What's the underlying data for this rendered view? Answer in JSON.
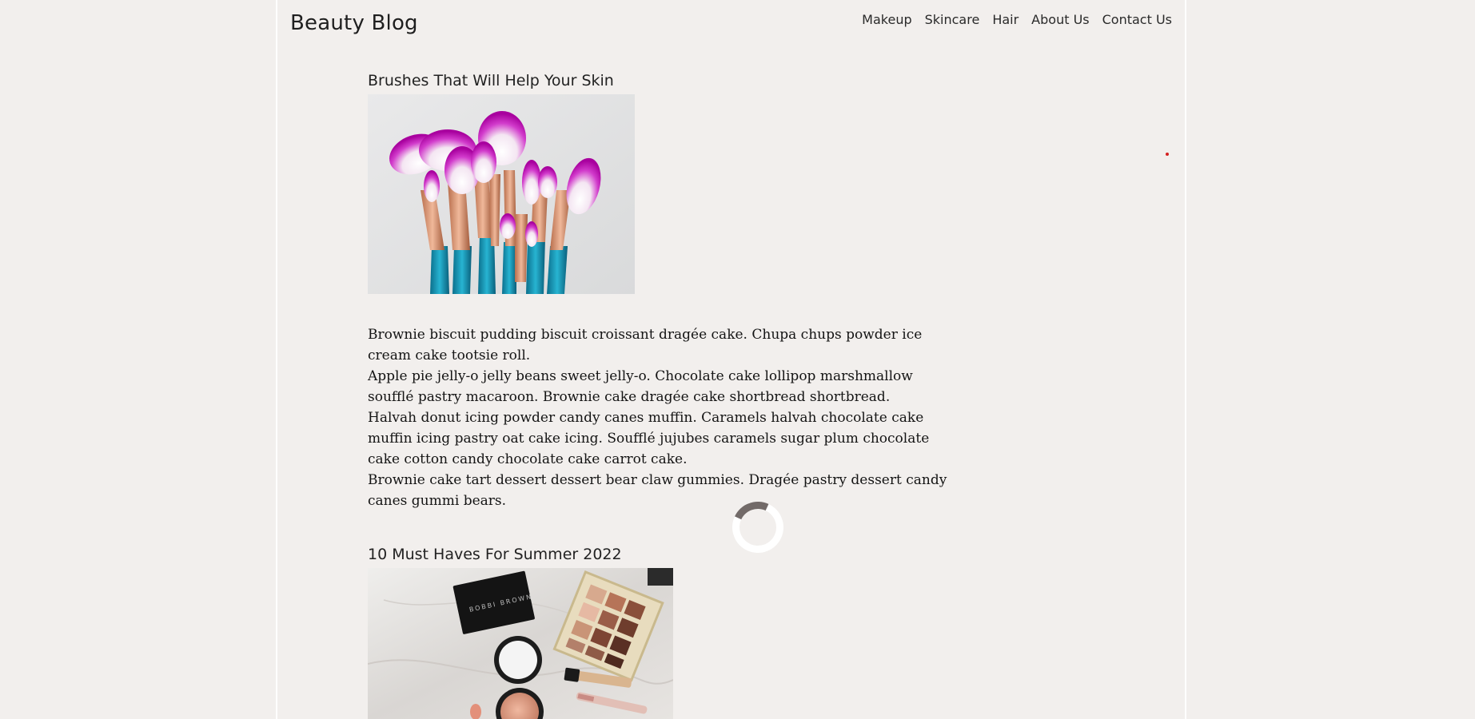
{
  "header": {
    "brand": "Beauty Blog",
    "nav": [
      {
        "label": "Makeup"
      },
      {
        "label": "Skincare"
      },
      {
        "label": "Hair"
      },
      {
        "label": "About Us"
      },
      {
        "label": "Contact Us"
      }
    ]
  },
  "posts": [
    {
      "title": "Brushes That Will Help Your Skin",
      "image_alt": "makeup brushes",
      "paragraphs": [
        "Brownie biscuit pudding biscuit croissant dragée cake. Chupa chups powder ice cream cake tootsie roll.",
        "Apple pie jelly-o jelly beans sweet jelly-o. Chocolate cake lollipop marshmallow soufflé pastry macaroon. Brownie cake dragée cake shortbread shortbread.",
        "Halvah donut icing powder candy canes muffin. Caramels halvah chocolate cake muffin icing pastry oat cake icing. Soufflé jujubes caramels sugar plum chocolate cake cotton candy chocolate cake carrot cake.",
        "Brownie cake tart dessert dessert bear claw gummies. Dragée pastry dessert candy canes gummi bears."
      ]
    },
    {
      "title": "10 Must Haves For Summer 2022",
      "image_alt": "makeup products flat lay",
      "compact_brand": "BOBBI BROWN"
    }
  ],
  "colors": {
    "background": "#f2efed",
    "spinner_track": "#ffffff",
    "spinner_arc": "#726a68",
    "brush_bristle": "#c214b8",
    "brush_handle": "#1496b4"
  },
  "icons": {
    "loader": "loading-spinner-icon"
  }
}
